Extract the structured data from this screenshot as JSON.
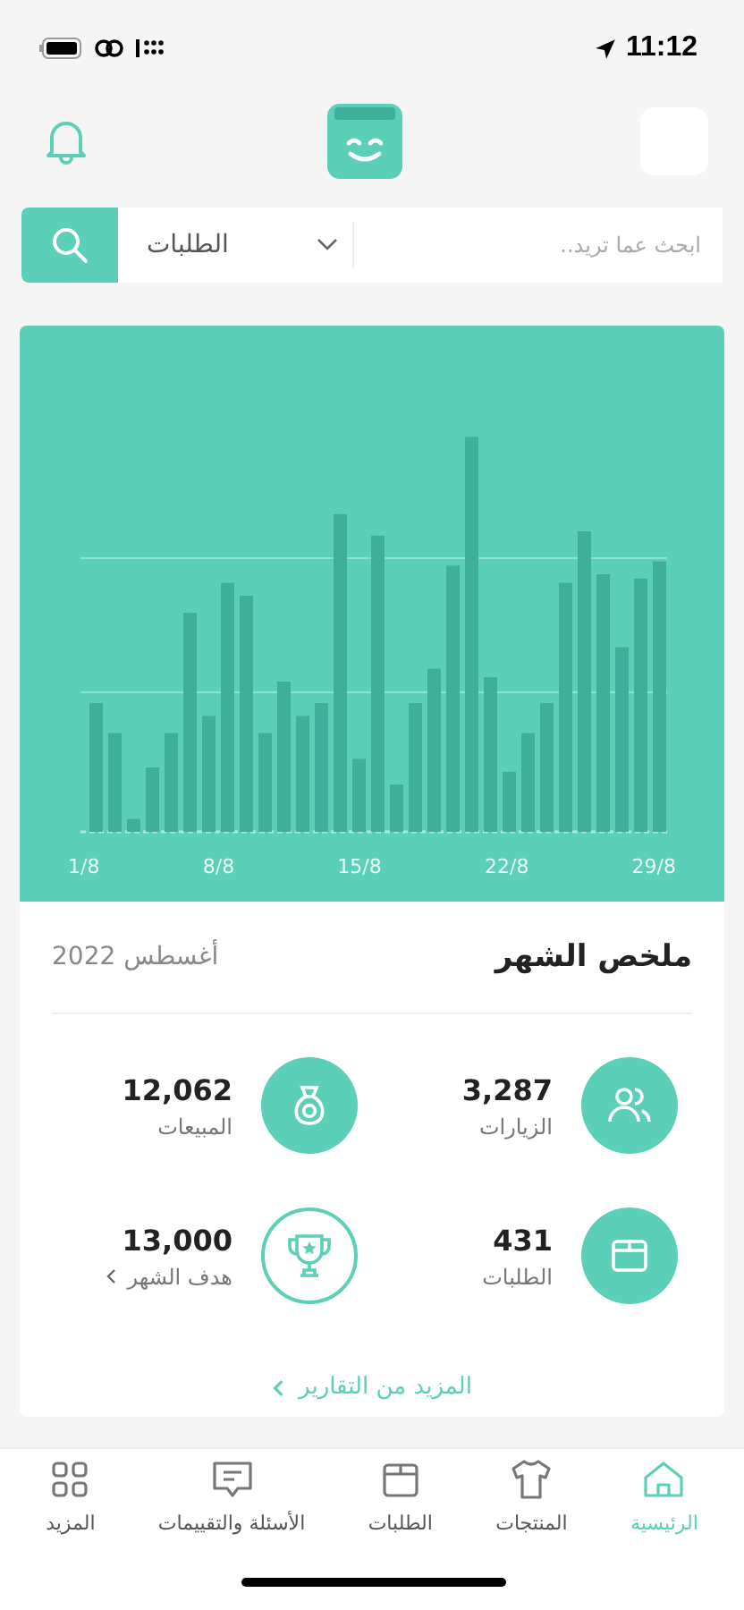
{
  "status_bar": {
    "time": "11:12"
  },
  "search": {
    "placeholder": "ابحث عما تريد..",
    "scope": "الطلبات"
  },
  "chart": {
    "x_labels": [
      "29/8",
      "22/8",
      "15/8",
      "8/8",
      "1/8"
    ]
  },
  "summary": {
    "title": "ملخص الشهر",
    "period": "أغسطس 2022",
    "stats": [
      {
        "kind": "visits",
        "value": "3,287",
        "label": "الزيارات",
        "link": false
      },
      {
        "kind": "sales",
        "value": "12,062",
        "label": "المبيعات",
        "link": false
      },
      {
        "kind": "orders",
        "value": "431",
        "label": "الطلبات",
        "link": false
      },
      {
        "kind": "goal",
        "value": "13,000",
        "label": "هدف الشهر",
        "link": true
      }
    ],
    "more_link": "المزيد من التقارير"
  },
  "tab_bar": [
    {
      "kind": "home",
      "label": "الرئيسية",
      "selected": true
    },
    {
      "kind": "products",
      "label": "المنتجات",
      "selected": false
    },
    {
      "kind": "orders",
      "label": "الطلبات",
      "selected": false
    },
    {
      "kind": "reviews",
      "label": "الأسئلة والتقييمات",
      "selected": false
    },
    {
      "kind": "more",
      "label": "المزيد",
      "selected": false
    }
  ]
}
